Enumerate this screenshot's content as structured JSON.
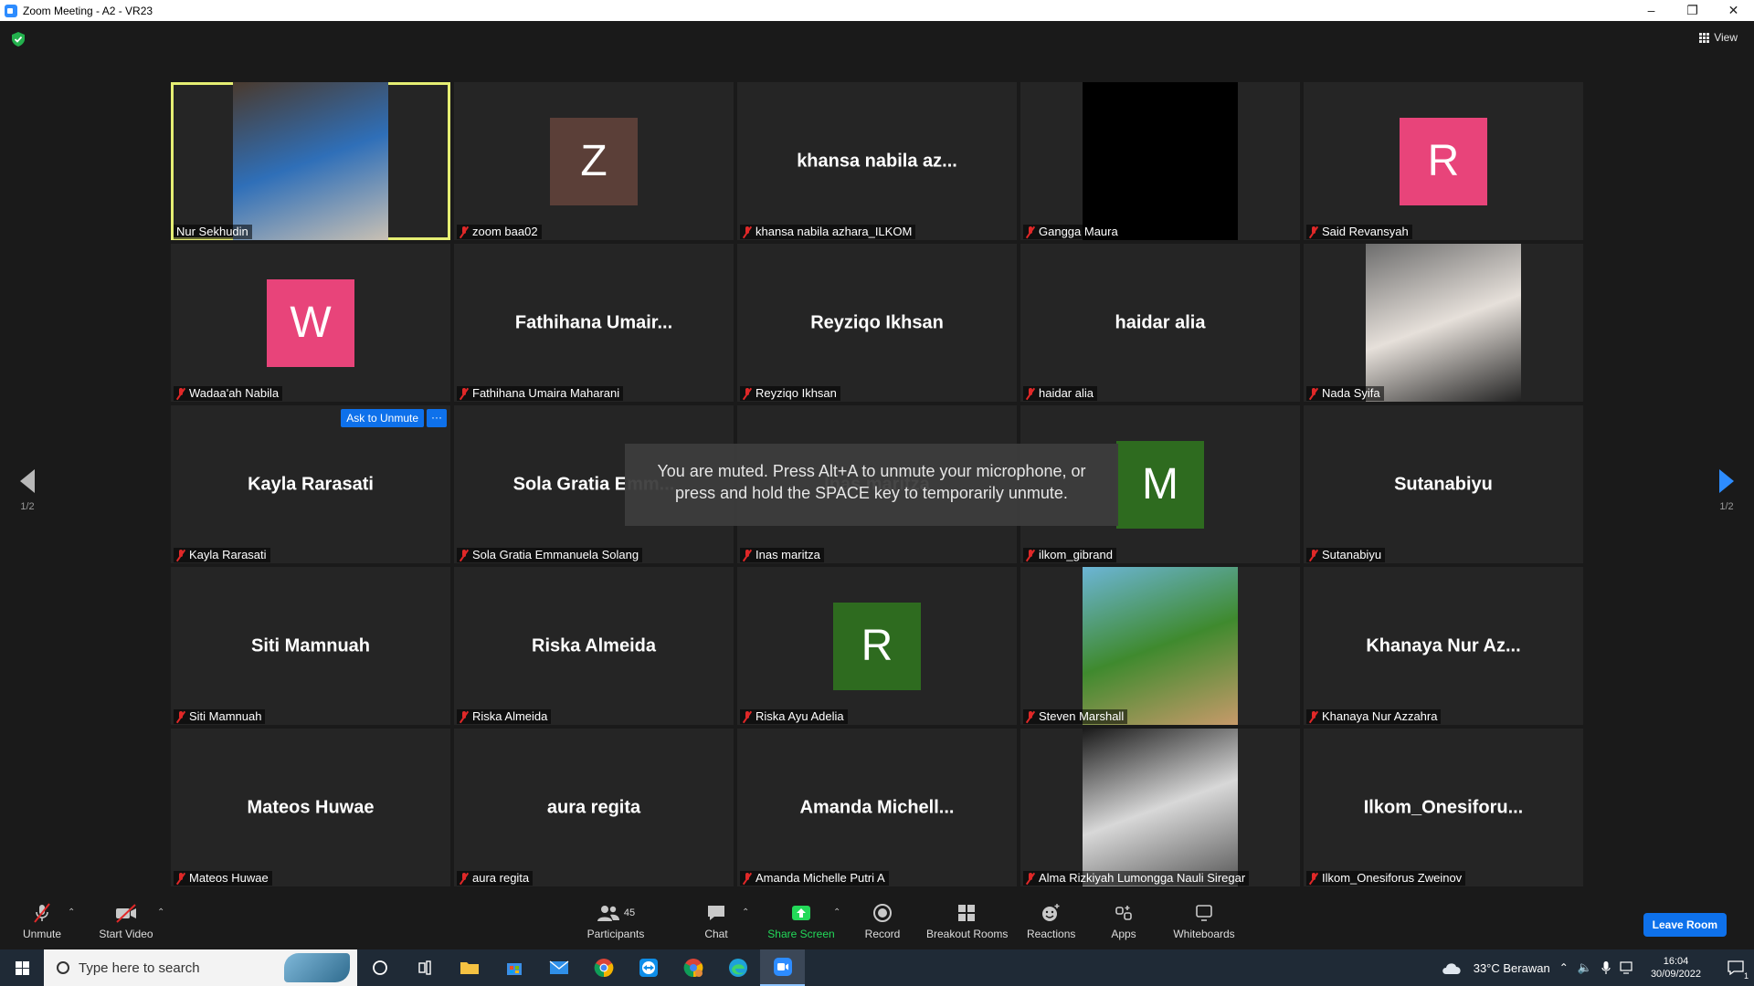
{
  "window": {
    "title": "Zoom Meeting - A2 - VR23",
    "controls": [
      "–",
      "❐",
      "✕"
    ]
  },
  "header": {
    "view_label": "View"
  },
  "pagination": {
    "left_page": "1/2",
    "right_page": "1/2"
  },
  "ask_unmute": {
    "ask_label": "Ask to Unmute",
    "more_label": "···"
  },
  "muted_toast": {
    "text": "You are muted. Press Alt+A to unmute your microphone, or press and hold the SPACE key to temporarily unmute."
  },
  "tiles": [
    {
      "kind": "video",
      "label": "Nur Sekhudin",
      "muted": false,
      "active": true,
      "video_colors": [
        "#4a3a2e",
        "#2f6fb8",
        "#c8c0b4"
      ]
    },
    {
      "kind": "avatar",
      "letter": "Z",
      "avatar_color": "#5b3f38",
      "label": "zoom baa02",
      "muted": true
    },
    {
      "kind": "name",
      "display": "khansa nabila az...",
      "label": "khansa nabila azhara_ILKOM",
      "muted": true
    },
    {
      "kind": "video",
      "label": "Gangga Maura",
      "muted": true,
      "video_colors": [
        "#000000",
        "#000000",
        "#000000"
      ]
    },
    {
      "kind": "avatar",
      "letter": "R",
      "avatar_color": "#e8447a",
      "label": "Said Revansyah",
      "muted": true
    },
    {
      "kind": "avatar",
      "letter": "W",
      "avatar_color": "#e8447a",
      "label": "Wadaa'ah Nabila",
      "muted": true
    },
    {
      "kind": "name",
      "display": "Fathihana  Umair...",
      "label": "Fathihana Umaira Maharani",
      "muted": true
    },
    {
      "kind": "name",
      "display": "Reyziqo Ikhsan",
      "label": "Reyziqo Ikhsan",
      "muted": true
    },
    {
      "kind": "name",
      "display": "haidar alia",
      "label": "haidar alia",
      "muted": true
    },
    {
      "kind": "video",
      "label": "Nada Syifa",
      "muted": true,
      "video_colors": [
        "#6d6d6d",
        "#e6e0da",
        "#222222"
      ]
    },
    {
      "kind": "name",
      "display": "Kayla Rarasati",
      "label": "Kayla Rarasati",
      "muted": true,
      "has_actions": true
    },
    {
      "kind": "name",
      "display": "Sola Gratia  Emm...",
      "label": "Sola Gratia Emmanuela Solang",
      "muted": true
    },
    {
      "kind": "name",
      "display": "Inas maritza",
      "label": "Inas maritza",
      "muted": true
    },
    {
      "kind": "avatar",
      "letter": "M",
      "avatar_color": "#2e6b1f",
      "label": "ilkom_gibrand",
      "muted": true
    },
    {
      "kind": "name",
      "display": "Sutanabiyu",
      "label": "Sutanabiyu",
      "muted": true
    },
    {
      "kind": "name",
      "display": "Siti Mamnuah",
      "label": "Siti Mamnuah",
      "muted": true
    },
    {
      "kind": "name",
      "display": "Riska Almeida",
      "label": "Riska Almeida",
      "muted": true
    },
    {
      "kind": "avatar",
      "letter": "R",
      "avatar_color": "#2e6b1f",
      "label": "Riska Ayu Adelia",
      "muted": true
    },
    {
      "kind": "video",
      "label": "Steven Marshall",
      "muted": true,
      "video_colors": [
        "#6cb5d6",
        "#3f8a2e",
        "#c79a6a"
      ]
    },
    {
      "kind": "name",
      "display": "Khanaya Nur Az...",
      "label": "Khanaya Nur Azzahra",
      "muted": true
    },
    {
      "kind": "name",
      "display": "Mateos Huwae",
      "label": "Mateos Huwae",
      "muted": true
    },
    {
      "kind": "name",
      "display": "aura regita",
      "label": "aura regita",
      "muted": true
    },
    {
      "kind": "name",
      "display": "Amanda  Michell...",
      "label": "Amanda Michelle Putri A",
      "muted": true
    },
    {
      "kind": "video",
      "label": "Alma Rizkiyah Lumongga Nauli Siregar",
      "muted": true,
      "video_colors": [
        "#1a1a1a",
        "#d8d8d8",
        "#555555"
      ]
    },
    {
      "kind": "name",
      "display": "Ilkom_Onesiforu...",
      "label": "Ilkom_Onesiforus Zweinov",
      "muted": true
    }
  ],
  "toolbar": {
    "unmute": "Unmute",
    "start_video": "Start Video",
    "participants": "Participants",
    "participants_count": "45",
    "chat": "Chat",
    "share_screen": "Share Screen",
    "record": "Record",
    "breakout_rooms": "Breakout Rooms",
    "reactions": "Reactions",
    "apps": "Apps",
    "whiteboards": "Whiteboards",
    "leave": "Leave Room"
  },
  "taskbar": {
    "search_placeholder": "Type here to search",
    "weather": "33°C  Berawan",
    "time": "16:04",
    "date": "30/09/2022",
    "notification_count": "1"
  }
}
